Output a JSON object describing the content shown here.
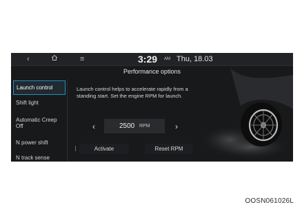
{
  "statusbar": {
    "back_icon": "chevron-left-icon",
    "home_icon": "home-icon",
    "menu_icon": "menu-icon",
    "time": "3:29",
    "ampm": "AM",
    "date": "Thu, 18.03"
  },
  "page_title": "Performance options",
  "sidebar": {
    "items": [
      {
        "label": "Launch control",
        "selected": true
      },
      {
        "label": "Shift light"
      },
      {
        "label": "Automatic Creep Off"
      },
      {
        "label": "N power shift"
      },
      {
        "label": "N track sense"
      }
    ]
  },
  "description": "Launch control helps to accelerate rapidly from a standing start. Set the engine RPM for launch.",
  "rpm": {
    "decrease_icon": "chevron-left-icon",
    "increase_icon": "chevron-right-icon",
    "value": "2500",
    "unit": "RPM"
  },
  "buttons": {
    "activate": "Activate",
    "reset": "Reset RPM"
  },
  "caption": "OOSN061026L",
  "colors": {
    "screen_bg": "#18191b",
    "accent": "#2a8fbd"
  }
}
